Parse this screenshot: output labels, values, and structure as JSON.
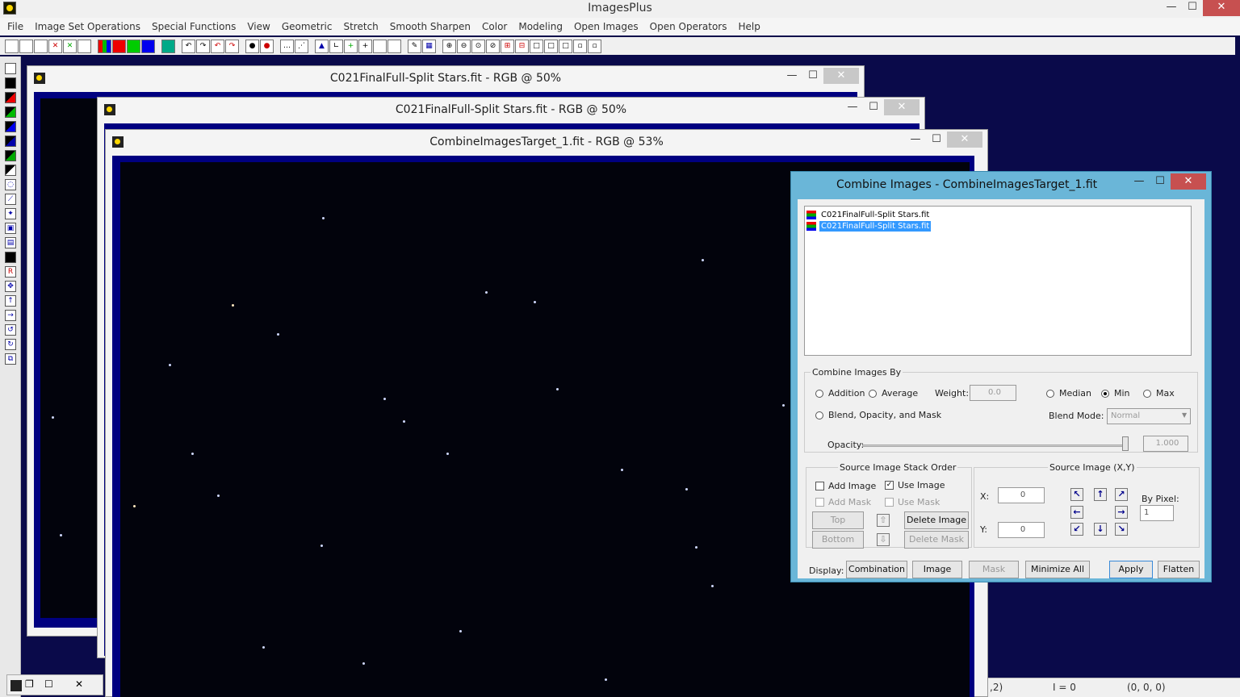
{
  "app": {
    "title": "ImagesPlus"
  },
  "menu": [
    "File",
    "Image Set Operations",
    "Special Functions",
    "View",
    "Geometric",
    "Stretch",
    "Smooth Sharpen",
    "Color",
    "Modeling",
    "Open Images",
    "Open Operators",
    "Help"
  ],
  "windows": [
    {
      "title": "C021FinalFull-Split Stars.fit - RGB @ 50%"
    },
    {
      "title": "C021FinalFull-Split Stars.fit - RGB @ 50%"
    },
    {
      "title": "CombineImagesTarget_1.fit - RGB @ 53%"
    }
  ],
  "dialog": {
    "title": "Combine Images - CombineImagesTarget_1.fit",
    "files": [
      "C021FinalFull-Split Stars.fit",
      "C021FinalFull-Split Stars.fit"
    ],
    "combine_by": {
      "legend": "Combine Images By",
      "addition": "Addition",
      "average": "Average",
      "weight_label": "Weight:",
      "weight_value": "0.0",
      "median": "Median",
      "min": "Min",
      "max": "Max",
      "blend": "Blend, Opacity, and Mask",
      "blend_mode_label": "Blend Mode:",
      "blend_mode_value": "Normal",
      "opacity_label": "Opacity:",
      "opacity_value": "1.000"
    },
    "stack": {
      "legend": "Source Image Stack Order",
      "add_image": "Add Image",
      "use_image": "Use Image",
      "add_mask": "Add Mask",
      "use_mask": "Use Mask",
      "top": "Top",
      "bottom": "Bottom",
      "delete_image": "Delete Image",
      "delete_mask": "Delete Mask"
    },
    "source": {
      "legend": "Source Image (X,Y)",
      "x_label": "X:",
      "x_value": "0",
      "y_label": "Y:",
      "y_value": "0",
      "by_pixel_label": "By Pixel:",
      "by_pixel_value": "1"
    },
    "display": {
      "label": "Display:",
      "combination": "Combination",
      "image": "Image",
      "mask": "Mask",
      "minimize_all": "Minimize All",
      "apply": "Apply",
      "flatten": "Flatten"
    }
  },
  "status": {
    "a": ",2)",
    "b": "I = 0",
    "c": "(0, 0, 0)"
  }
}
